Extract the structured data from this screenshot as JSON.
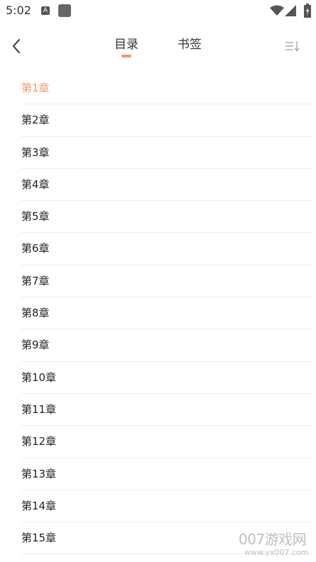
{
  "status_bar": {
    "time": "5:02",
    "notif_app_letter": "A"
  },
  "header": {
    "tabs": [
      {
        "label": "目录",
        "active": true
      },
      {
        "label": "书签",
        "active": false
      }
    ]
  },
  "colors": {
    "accent": "#EE9A6B",
    "text": "#222222",
    "divider": "#eeeeee"
  },
  "icons": {
    "back": "chevron-left-icon",
    "sort": "sort-icon",
    "wifi": "wifi-icon",
    "signal": "signal-icon",
    "battery": "battery-charging-icon"
  },
  "chapters": [
    {
      "label": "第1章",
      "active": true
    },
    {
      "label": "第2章"
    },
    {
      "label": "第3章"
    },
    {
      "label": "第4章"
    },
    {
      "label": "第5章"
    },
    {
      "label": "第6章"
    },
    {
      "label": "第7章"
    },
    {
      "label": "第8章"
    },
    {
      "label": "第9章"
    },
    {
      "label": "第10章"
    },
    {
      "label": "第11章"
    },
    {
      "label": "第12章"
    },
    {
      "label": "第13章"
    },
    {
      "label": "第14章"
    },
    {
      "label": "第15章"
    }
  ],
  "watermark": {
    "logo_text": "007游戏网",
    "url": "www.yx007.com"
  }
}
